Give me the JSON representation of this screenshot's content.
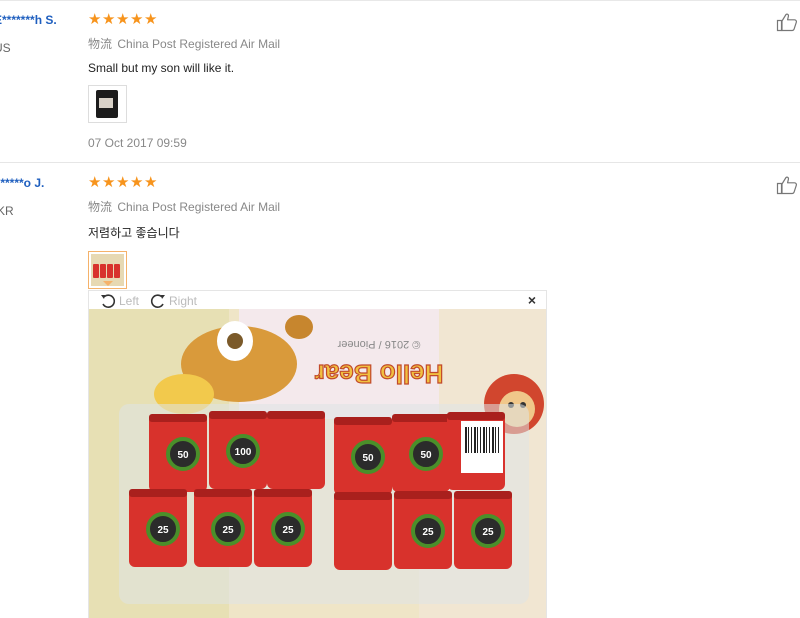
{
  "reviews": [
    {
      "user": "E*******h S.",
      "country": "US",
      "rating": 5,
      "logistics_label": "物流",
      "logistics": "China Post Registered Air Mail",
      "feedback": "Small but my son will like it.",
      "date": "07 Oct 2017 09:59"
    },
    {
      "user": "I*****o J.",
      "country": "KR",
      "rating": 5,
      "logistics_label": "物流",
      "logistics": "China Post Registered Air Mail",
      "feedback": "저렴하고 좋습니다"
    }
  ],
  "viewer": {
    "rotate_left": "Left",
    "rotate_right": "Right",
    "close": "×",
    "photo_text": {
      "package_title": "Hello Bear",
      "target_labels": [
        "50",
        "100",
        "50",
        "50",
        "25",
        "25",
        "25",
        "25",
        "25"
      ]
    }
  },
  "colors": {
    "star": "#f7941d",
    "username": "#1f5fbf",
    "can_red": "#d8322c",
    "target_green": "#4a8f2a"
  },
  "icons": {
    "helpful": "thumbs-up-icon",
    "rotate_left": "rotate-ccw-icon",
    "rotate_right": "rotate-cw-icon",
    "close": "close-icon"
  }
}
